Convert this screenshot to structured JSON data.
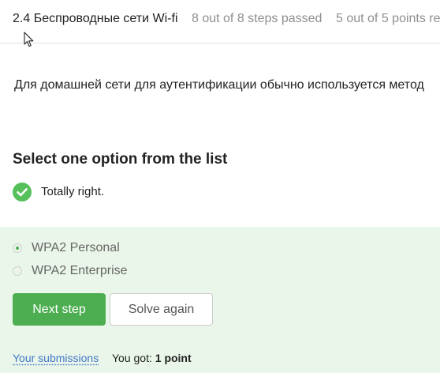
{
  "header": {
    "lesson_title": "2.4 Беспроводные сети Wi-fi",
    "steps_status": "8 out of 8 steps passed",
    "points_status": "5 out of 5 points  re"
  },
  "question": {
    "text": "Для домашней сети для аутентификации обычно используется метод"
  },
  "task": {
    "heading": "Select one option from the list",
    "feedback": "Totally right.",
    "feedback_icon": "check-circle-icon",
    "success_color": "#4cae50"
  },
  "options": [
    {
      "label": "WPA2 Personal",
      "selected": true
    },
    {
      "label": "WPA2 Enterprise",
      "selected": false
    }
  ],
  "buttons": {
    "next_label": "Next step",
    "solve_again_label": "Solve again"
  },
  "footer": {
    "submissions_link": "Your submissions",
    "score_prefix": "You got: ",
    "score_value": "1 point"
  }
}
